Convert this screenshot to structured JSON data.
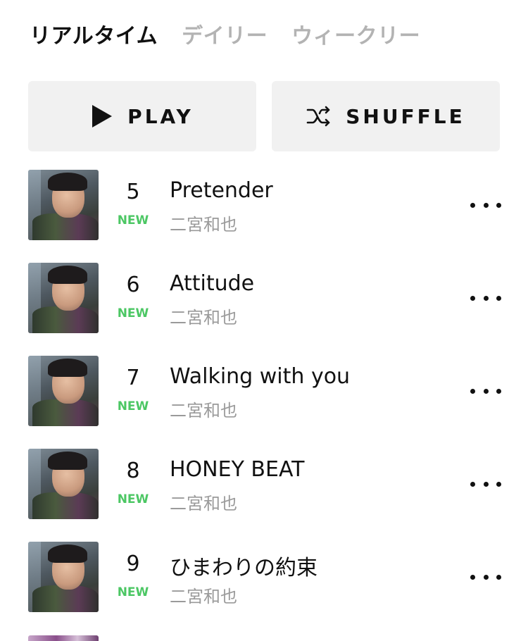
{
  "tabs": [
    {
      "label": "リアルタイム",
      "active": true
    },
    {
      "label": "デイリー",
      "active": false
    },
    {
      "label": "ウィークリー",
      "active": false
    }
  ],
  "actions": {
    "play_label": "PLAY",
    "shuffle_label": "SHUFFLE",
    "play_icon": "play-icon",
    "shuffle_icon": "shuffle-icon"
  },
  "tracks": [
    {
      "rank": "5",
      "badge": "NEW",
      "title": "Pretender",
      "artist": "二宮和也"
    },
    {
      "rank": "6",
      "badge": "NEW",
      "title": "Attitude",
      "artist": "二宮和也"
    },
    {
      "rank": "7",
      "badge": "NEW",
      "title": "Walking with you",
      "artist": "二宮和也"
    },
    {
      "rank": "8",
      "badge": "NEW",
      "title": "HONEY BEAT",
      "artist": "二宮和也"
    },
    {
      "rank": "9",
      "badge": "NEW",
      "title": "ひまわりの約束",
      "artist": "二宮和也"
    }
  ],
  "colors": {
    "accent_new": "#4cc764",
    "button_bg": "#f1f1f1",
    "inactive_tab": "#b3b3b3",
    "secondary_text": "#9a9a9a"
  }
}
